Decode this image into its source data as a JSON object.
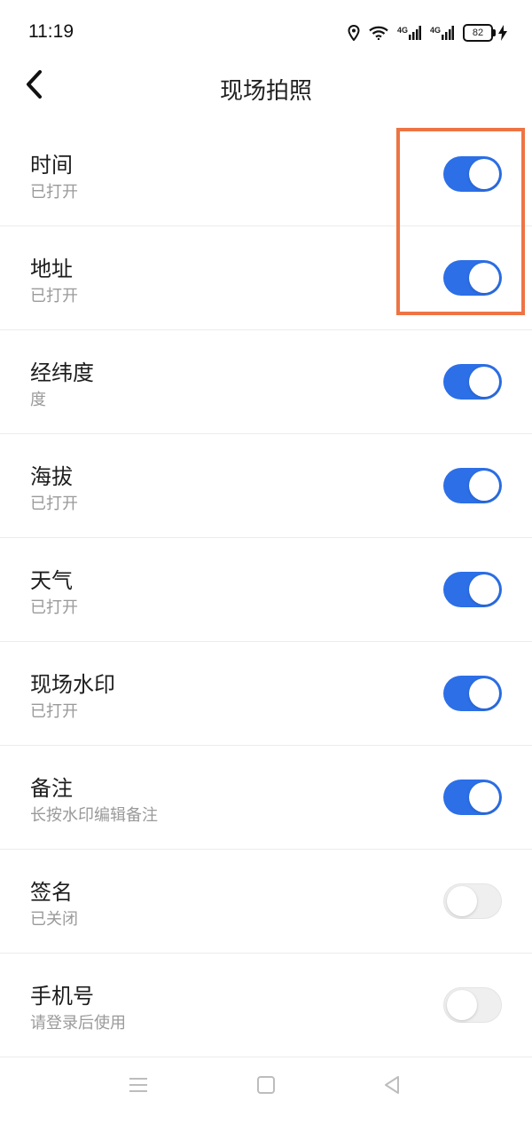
{
  "status_bar": {
    "time": "11:19",
    "signal_1_label": "4G",
    "signal_2_label": "4G",
    "battery_level": "82"
  },
  "header": {
    "title": "现场拍照",
    "back_icon": "chevron-left-icon"
  },
  "settings": [
    {
      "title": "时间",
      "subtitle": "已打开",
      "enabled": true
    },
    {
      "title": "地址",
      "subtitle": "已打开",
      "enabled": true
    },
    {
      "title": "经纬度",
      "subtitle": "度",
      "enabled": true
    },
    {
      "title": "海拔",
      "subtitle": "已打开",
      "enabled": true
    },
    {
      "title": "天气",
      "subtitle": "已打开",
      "enabled": true
    },
    {
      "title": "现场水印",
      "subtitle": "已打开",
      "enabled": true
    },
    {
      "title": "备注",
      "subtitle": "长按水印编辑备注",
      "enabled": true
    },
    {
      "title": "签名",
      "subtitle": "已关闭",
      "enabled": false
    },
    {
      "title": "手机号",
      "subtitle": "请登录后使用",
      "enabled": false
    }
  ],
  "colors": {
    "toggle_on": "#2c6fe7",
    "toggle_off": "#efefef",
    "highlight": "#ee7444"
  },
  "nav_bar": {
    "icons": [
      "menu-icon",
      "home-square-icon",
      "back-triangle-icon"
    ]
  }
}
